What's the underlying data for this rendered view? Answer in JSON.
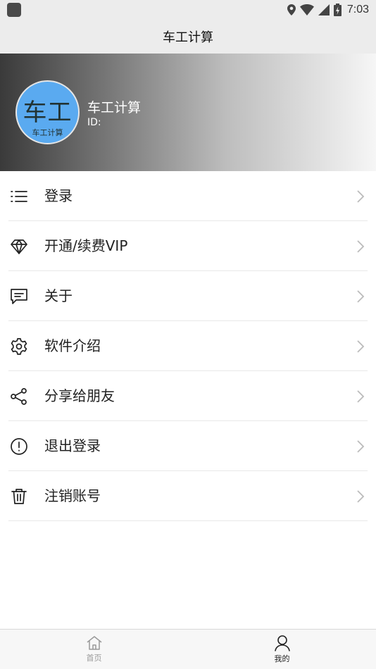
{
  "status_bar": {
    "time": "7:03"
  },
  "title_bar": {
    "title": "车工计算"
  },
  "profile": {
    "avatar_main": "车工",
    "avatar_sub": "车工计算",
    "name": "车工计算",
    "id_label": "ID:"
  },
  "menu": {
    "items": [
      {
        "label": "登录",
        "icon": "list-icon"
      },
      {
        "label": "开通/续费VIP",
        "icon": "diamond-icon"
      },
      {
        "label": "关于",
        "icon": "message-icon"
      },
      {
        "label": "软件介绍",
        "icon": "gear-icon"
      },
      {
        "label": "分享给朋友",
        "icon": "share-icon"
      },
      {
        "label": "退出登录",
        "icon": "alert-circle-icon"
      },
      {
        "label": "注销账号",
        "icon": "trash-icon"
      }
    ]
  },
  "tab_bar": {
    "tabs": [
      {
        "label": "首页",
        "icon": "home-icon",
        "active": false
      },
      {
        "label": "我的",
        "icon": "user-icon",
        "active": true
      }
    ]
  },
  "colors": {
    "avatar_bg": "#5aaaf0",
    "bar_bg": "#ececec",
    "active_tab": "#222222",
    "inactive_tab": "#999999"
  }
}
